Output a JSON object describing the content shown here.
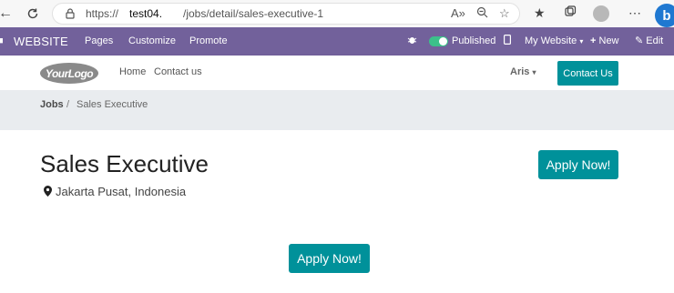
{
  "browser": {
    "url_scheme": "https://",
    "url_host": "test04.",
    "url_path": "/jobs/detail/sales-executive-1",
    "read_aloud_icon": "A»",
    "zoom_icon": "zoom-icon",
    "bing_label": "b"
  },
  "editor_bar": {
    "app_label": "WEBSITE",
    "pages_label": "Pages",
    "customize_label": "Customize",
    "promote_label": "Promote",
    "published_label": "Published",
    "my_website_label": "My Website",
    "new_label": "New",
    "edit_label": "Edit",
    "bar_color": "#72619b"
  },
  "site_header": {
    "logo_text": "YourLogo",
    "menu": [
      "Home",
      "Contact us"
    ],
    "user_name": "Aris",
    "contact_button": "Contact Us",
    "accent_color": "#00919a"
  },
  "breadcrumb": {
    "root": "Jobs",
    "separator": "/",
    "current": "Sales Executive"
  },
  "job": {
    "title": "Sales Executive",
    "location": "Jakarta Pusat, Indonesia",
    "apply_label_top": "Apply Now!",
    "apply_label_bottom": "Apply Now!"
  }
}
